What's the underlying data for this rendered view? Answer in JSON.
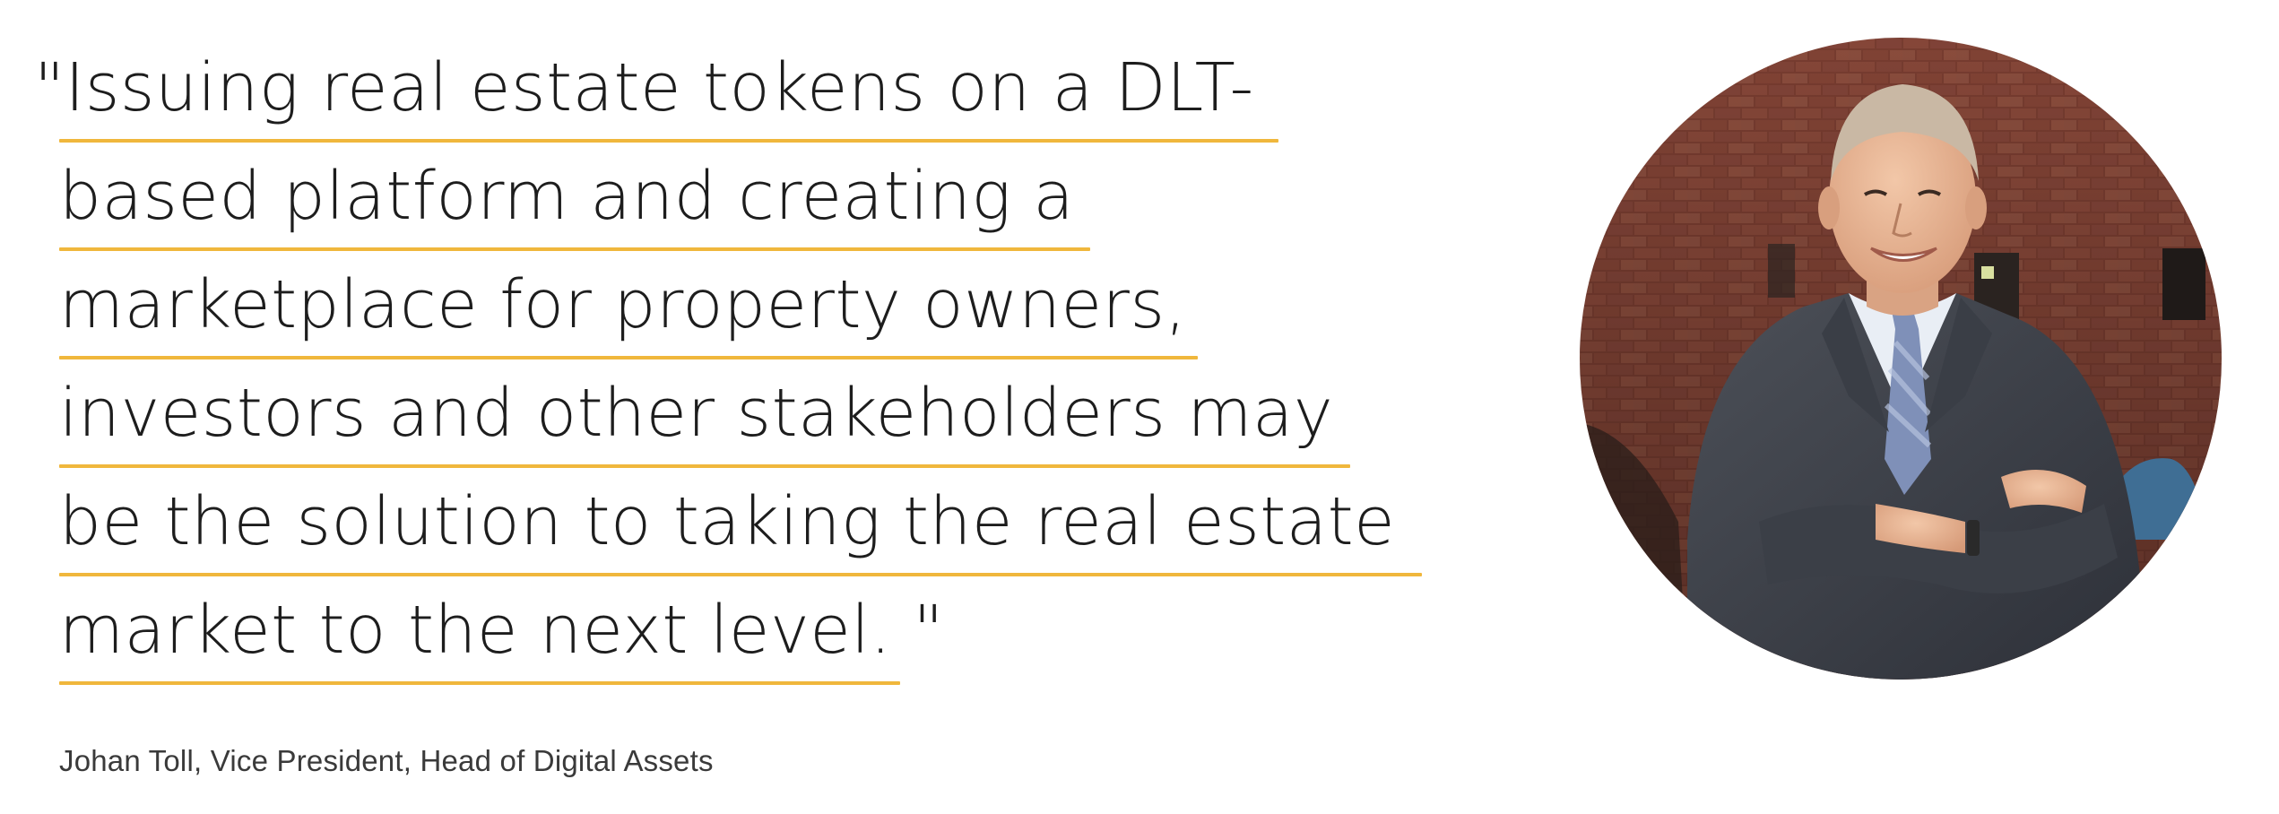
{
  "quote": {
    "lines": [
      "\"Issuing real estate tokens on a DLT-",
      "based platform and creating a",
      "marketplace for property owners,",
      "investors and other stakeholders may",
      "be the solution to taking the real estate",
      "market to the next level. \""
    ]
  },
  "attribution": "Johan Toll, Vice President, Head of Digital Assets",
  "portrait": {
    "icon": "person-portrait-photo"
  },
  "colors": {
    "accent_underline": "#f0b73c",
    "text": "#1d1d1d",
    "brick": "#8a4a3b"
  }
}
